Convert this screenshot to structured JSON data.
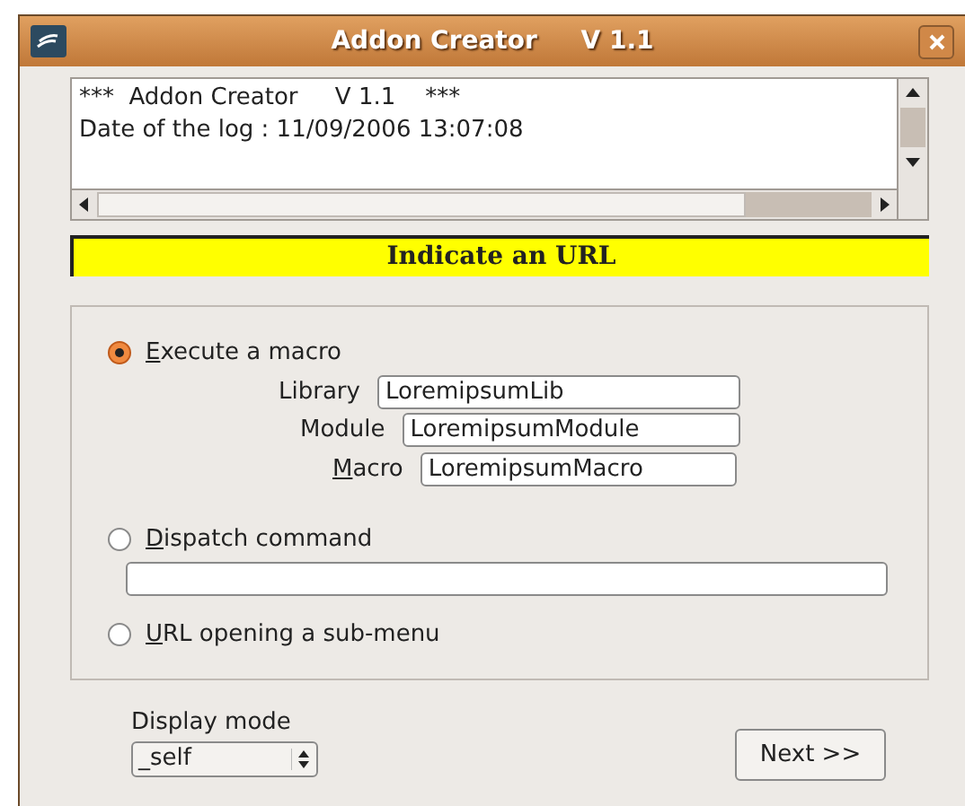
{
  "window": {
    "title": "Addon Creator     V 1.1"
  },
  "log": {
    "lines": [
      "***  Addon Creator     V 1.1    ***",
      "Date of the log : 11/09/2006 13:07:08"
    ]
  },
  "banner": "Indicate an URL",
  "options": [
    {
      "kind": "macro",
      "key": "E",
      "rest": "xecute a macro",
      "selected": true,
      "fields": [
        {
          "rest": "Library",
          "value": "LoremipsumLib"
        },
        {
          "rest": "Module",
          "value": "LoremipsumModule"
        },
        {
          "key": "M",
          "rest": "acro",
          "value": "LoremipsumMacro"
        }
      ]
    },
    {
      "kind": "command",
      "key": "D",
      "rest": "ispatch command",
      "selected": false
    },
    {
      "kind": "plain",
      "key": "U",
      "rest": "RL opening a sub-menu",
      "selected": false
    }
  ],
  "display_mode": {
    "label": "Display mode",
    "value": "_self"
  },
  "next_button": "Next >>"
}
